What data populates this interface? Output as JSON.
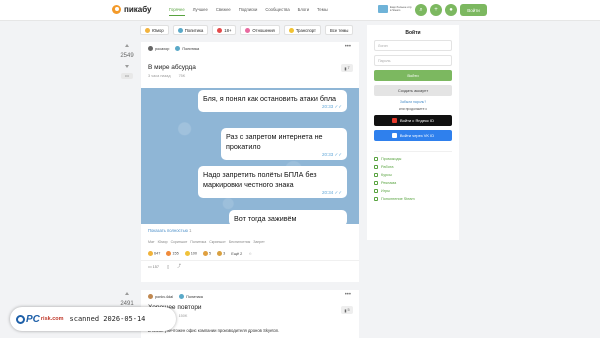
{
  "header": {
    "logo_text": "пикабу",
    "nav": [
      "Горячее",
      "Лучшее",
      "Свежее",
      "Подписки",
      "Сообщества",
      "Блоги",
      "Темы"
    ],
    "promo_text": "Ещё больше игр в Steam",
    "login_label": "Войти"
  },
  "tags": [
    {
      "label": "Юмор",
      "color": "#f2b33d"
    },
    {
      "label": "Политика",
      "color": "#5aa9c8"
    },
    {
      "label": "18+",
      "color": "#e34b4b"
    },
    {
      "label": "Отношения",
      "color": "#e86aa0"
    },
    {
      "label": "Транспорт",
      "color": "#f1c232"
    },
    {
      "label": "Все темы",
      "color": ""
    }
  ],
  "post1": {
    "rating": "2549",
    "author": "pocaxop",
    "community": "Политика",
    "title": "В мире абсурда",
    "time": "3 часа назад",
    "views": "75K",
    "saves": "7",
    "messages": [
      {
        "text": "Бля, я понял как остановить атаки бпла",
        "time": "20:33"
      },
      {
        "text": "Раз с запретом интернета не прокатило",
        "time": "20:33"
      },
      {
        "text": "Надо запретить полёты БПЛА без маркировки честного знака",
        "time": "20:34"
      },
      {
        "text": "Вот тогда заживём",
        "time": ""
      }
    ],
    "read_more": "Показать полностью",
    "read_more_count": "1",
    "tags": [
      "Мат",
      "Юмор",
      "Скриншот",
      "Политика",
      "Скриншот",
      "Беспилотник",
      "Запрет"
    ],
    "reactions": [
      {
        "count": "647",
        "color": "#f0b23a"
      },
      {
        "count": "155",
        "color": "#f08a3a"
      },
      {
        "count": "100",
        "color": "#f0c23a"
      },
      {
        "count": "5",
        "color": "#e0a040"
      },
      {
        "count": "3",
        "color": "#d8a040"
      },
      {
        "count": "Ещё 2",
        "color": ""
      }
    ],
    "comments": "157"
  },
  "post2": {
    "rating": "2491",
    "author": "ponkv.4dal",
    "community": "Политика",
    "title": "Хорошее повтори",
    "time": "3 часа назад",
    "views": "150K",
    "saves": "5",
    "body": "В Киеве уничтожен офис компании производителя дронов Skyeton."
  },
  "sidebar": {
    "title": "Войти",
    "login_placeholder": "Логин",
    "password_placeholder": "Пароль",
    "login_button": "Войти",
    "register_button": "Создать аккаунт",
    "forgot": "Забыли пароль?",
    "or_continue": "или продолжите с",
    "yandex_button": "Войти с Яндекс ID",
    "vk_button": "Войти через VK ID",
    "links": [
      "Промокоды",
      "Работа",
      "Курсы",
      "Реклама",
      "Игры",
      "Пополнение Steam"
    ]
  },
  "watermark": {
    "logo_pc": "PC",
    "logo_risk": "risk.com",
    "text": "scanned 2026-05-14"
  }
}
